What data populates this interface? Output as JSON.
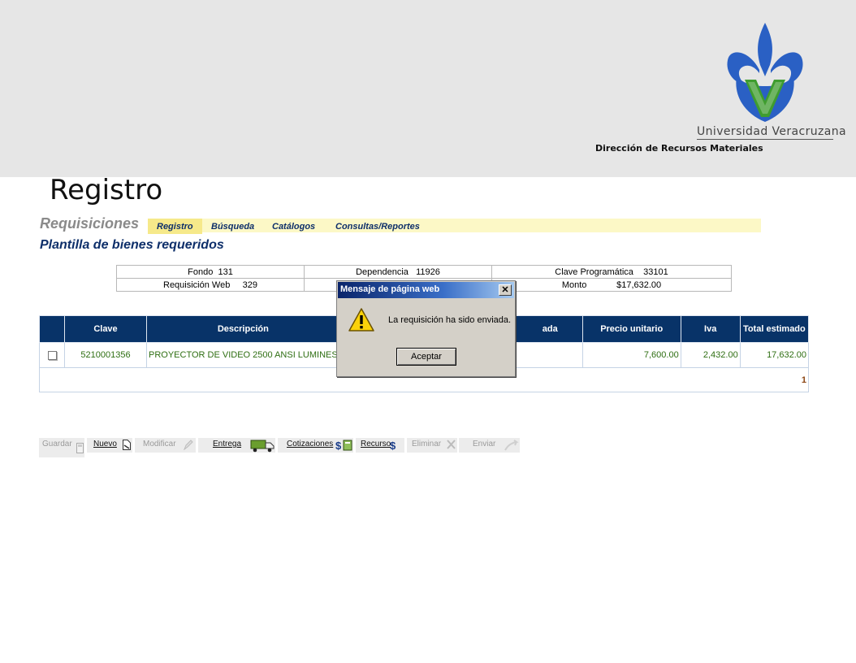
{
  "header": {
    "university": "Universidad Veracruzana",
    "department": "Dirección de Recursos Materiales",
    "logo_icon": "uv-fleur-de-lis-logo",
    "colors": {
      "logo_blue": "#2a60c4",
      "logo_green": "#3f9d2f",
      "band": "#e6e6e6"
    }
  },
  "page_title": "Registro",
  "section_title": "Requisiciones",
  "nav": {
    "tabs": [
      {
        "label": "Registro",
        "active": true
      },
      {
        "label": "Búsqueda",
        "active": false
      },
      {
        "label": "Catálogos",
        "active": false
      },
      {
        "label": "Consultas/Reportes",
        "active": false
      }
    ]
  },
  "subtitle": "Plantilla de bienes requeridos",
  "info": {
    "fondo_label": "Fondo",
    "fondo_value": "131",
    "dependencia_label": "Dependencia",
    "dependencia_value": "11926",
    "clave_prog_label": "Clave Programática",
    "clave_prog_value": "33101",
    "requisicion_label": "Requisición Web",
    "requisicion_value": "329",
    "monto_label": "Monto",
    "monto_value": "$17,632.00"
  },
  "table": {
    "headers": [
      "",
      "Clave",
      "Descripción",
      "ada",
      "Precio unitario",
      "Iva",
      "Total estimado"
    ],
    "rows": [
      {
        "clave": "5210001356",
        "descripcion": "PROYECTOR DE VIDEO 2500 ANSI LUMINES",
        "cantidad": "",
        "precio": "7,600.00",
        "iva": "2,432.00",
        "total": "17,632.00"
      }
    ],
    "page": "1",
    "colors": {
      "header_bg": "#083368",
      "cell_text": "#2e6e12"
    }
  },
  "toolbar": {
    "buttons": [
      {
        "label": "Guardar",
        "enabled": false,
        "icon": "disk-icon"
      },
      {
        "label": "Nuevo",
        "enabled": true,
        "icon": "new-document-icon"
      },
      {
        "label": "Modificar",
        "enabled": false,
        "icon": "pencil-icon"
      },
      {
        "label": "Entrega",
        "enabled": true,
        "icon": "truck-icon"
      },
      {
        "label": "Cotizaciones",
        "enabled": true,
        "icon": "dollar-calculator-icon"
      },
      {
        "label": "Recurso",
        "enabled": true,
        "icon": "dollar-icon"
      },
      {
        "label": "Eliminar",
        "enabled": false,
        "icon": "x-icon"
      },
      {
        "label": "Enviar",
        "enabled": false,
        "icon": "send-arrow-icon"
      }
    ]
  },
  "dialog": {
    "title": "Mensaje de página web",
    "message": "La requisición ha sido enviada.",
    "ok_label": "Aceptar",
    "close_glyph": "✕",
    "icon": "warning-icon"
  }
}
